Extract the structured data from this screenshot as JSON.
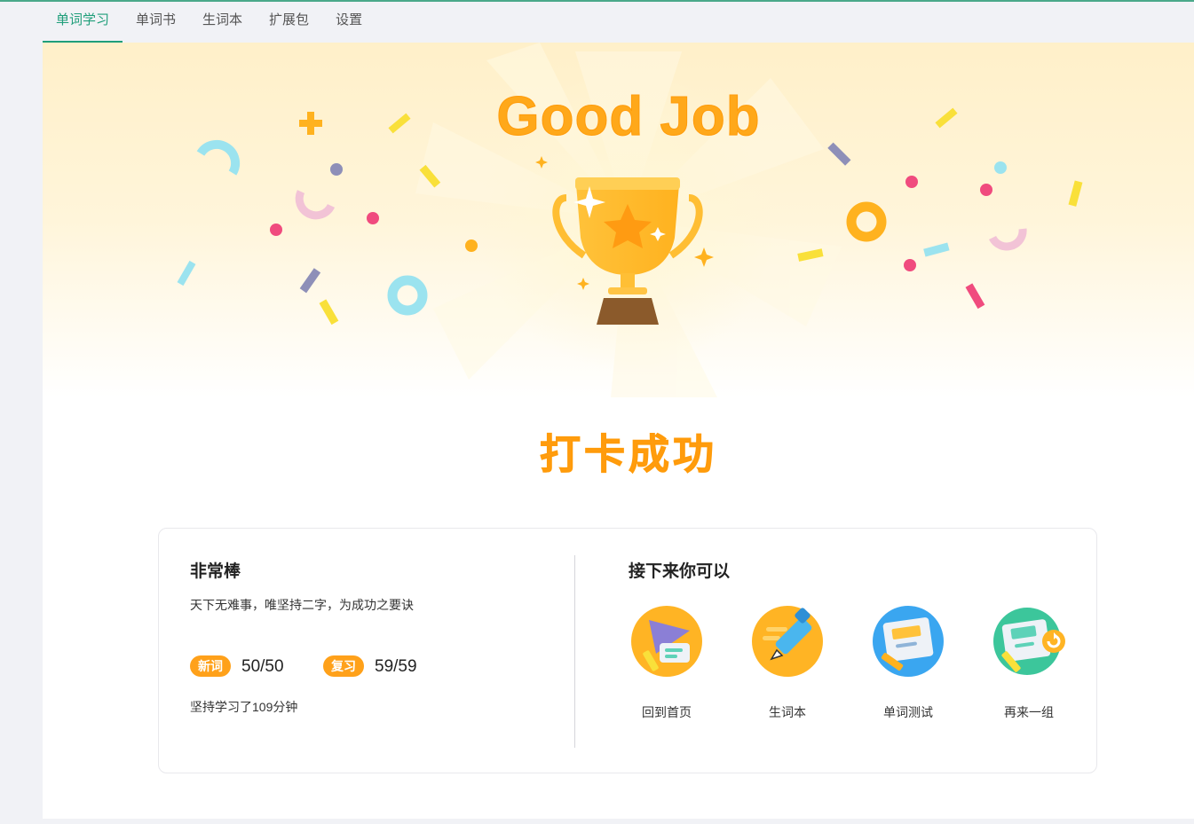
{
  "nav": {
    "tabs": [
      {
        "label": "单词学习",
        "active": true
      },
      {
        "label": "单词书"
      },
      {
        "label": "生词本"
      },
      {
        "label": "扩展包"
      },
      {
        "label": "设置"
      }
    ]
  },
  "hero": {
    "title": "Good Job",
    "subtitle": "打卡成功",
    "trophy_icon": "trophy-icon",
    "accent": "#ffa81a"
  },
  "summary": {
    "title": "非常棒",
    "quote": "天下无难事，唯坚持二字，为成功之要诀",
    "new_words": {
      "badge": "新词",
      "value": "50/50"
    },
    "review": {
      "badge": "复习",
      "value": "59/59"
    },
    "study_time": "坚持学习了109分钟"
  },
  "next": {
    "title": "接下来你可以",
    "actions": [
      {
        "label": "回到首页",
        "icon": "home-flag-icon"
      },
      {
        "label": "生词本",
        "icon": "notebook-pen-icon"
      },
      {
        "label": "单词测试",
        "icon": "test-paper-icon"
      },
      {
        "label": "再来一组",
        "icon": "repeat-card-icon"
      }
    ]
  },
  "colors": {
    "brand_green": "#1f9e7a",
    "badge_orange": "#ffa11a"
  }
}
